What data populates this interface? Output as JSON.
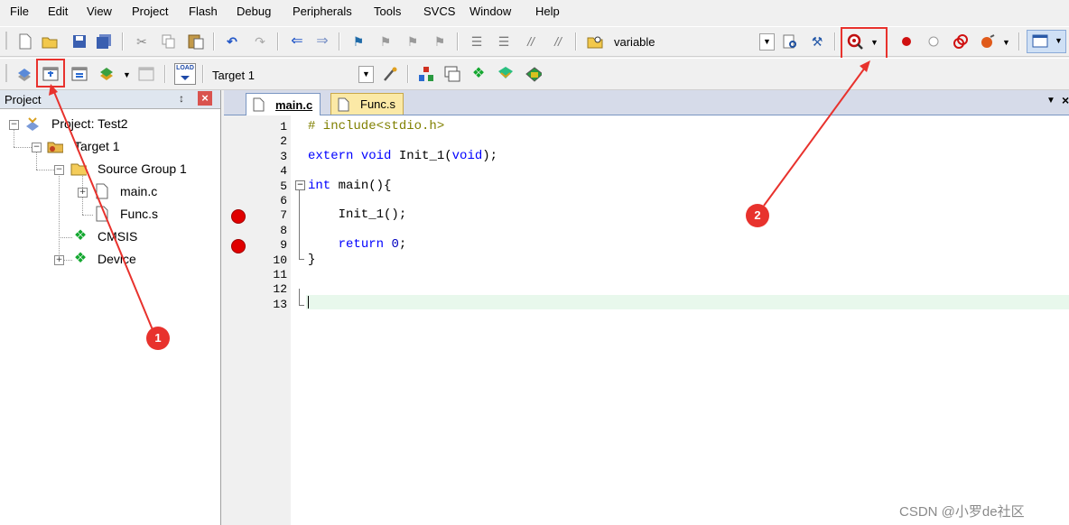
{
  "menu": [
    "File",
    "Edit",
    "View",
    "Project",
    "Flash",
    "Debug",
    "Peripherals",
    "Tools",
    "SVCS",
    "Window",
    "Help"
  ],
  "toolbar1": {
    "find_field_value": "variable"
  },
  "toolbar2": {
    "target_select_value": "Target 1",
    "load_label": "LOAD"
  },
  "project_panel": {
    "title": "Project",
    "pin_glyph": "↕",
    "close_glyph": "×",
    "tree": {
      "project": "Project: Test2",
      "target": "Target 1",
      "group": "Source Group 1",
      "file_main": "main.c",
      "file_func": "Func.s",
      "cmsis": "CMSIS",
      "device": "Device"
    }
  },
  "editor": {
    "tabs": [
      "main.c",
      "Func.s"
    ],
    "tab_menu_glyph": "▼",
    "tab_close_glyph": "×",
    "lines": [
      {
        "n": "1",
        "code": "# include<stdio.h>"
      },
      {
        "n": "2",
        "code": ""
      },
      {
        "n": "3",
        "code": "extern void Init_1(void);"
      },
      {
        "n": "4",
        "code": ""
      },
      {
        "n": "5",
        "code": "int main(){"
      },
      {
        "n": "6",
        "code": ""
      },
      {
        "n": "7",
        "code": "    Init_1();"
      },
      {
        "n": "8",
        "code": ""
      },
      {
        "n": "9",
        "code": "    return 0;"
      },
      {
        "n": "10",
        "code": "}"
      },
      {
        "n": "11",
        "code": ""
      },
      {
        "n": "12",
        "code": ""
      },
      {
        "n": "13",
        "code": ""
      }
    ],
    "breakpoint_lines": [
      7,
      9
    ],
    "fold_glyph": "−"
  },
  "annotations": {
    "callout_1": "1",
    "callout_2": "2"
  },
  "watermark": "CSDN @小罗de社区",
  "colors": {
    "highlight_box": "#e8322d",
    "keyword": "#0000ff",
    "preproc": "#808000",
    "current_line": "#e8f8ec",
    "breakpoint": "#e00000"
  }
}
